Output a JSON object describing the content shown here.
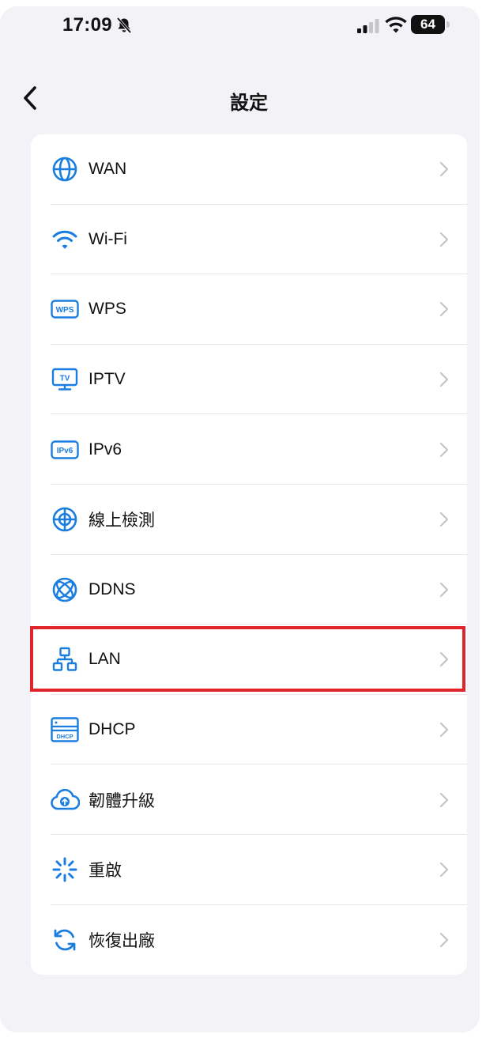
{
  "status_bar": {
    "time": "17:09",
    "battery": "64",
    "icons": [
      "bell-slash-icon",
      "cellular-signal-icon",
      "wifi-icon",
      "battery-icon"
    ]
  },
  "nav": {
    "back_icon": "chevron-left-icon",
    "title": "設定"
  },
  "settings": {
    "items": [
      {
        "label": "WAN",
        "icon": "globe-icon"
      },
      {
        "label": "Wi-Fi",
        "icon": "wifi-icon"
      },
      {
        "label": "WPS",
        "icon": "wps-icon",
        "icon_text": "WPS"
      },
      {
        "label": "IPTV",
        "icon": "tv-icon",
        "icon_text": "TV"
      },
      {
        "label": "IPv6",
        "icon": "ipv6-icon",
        "icon_text": "IPv6"
      },
      {
        "label": "線上檢測",
        "icon": "crosshair-icon"
      },
      {
        "label": "DDNS",
        "icon": "orbit-globe-icon"
      },
      {
        "label": "LAN",
        "icon": "network-topology-icon",
        "highlighted": true
      },
      {
        "label": "DHCP",
        "icon": "dhcp-server-icon",
        "icon_text": "DHCP"
      },
      {
        "label": "韌體升級",
        "icon": "cloud-upload-icon"
      },
      {
        "label": "重啟",
        "icon": "reboot-spinner-icon"
      },
      {
        "label": "恢復出廠",
        "icon": "reset-arrows-icon"
      }
    ]
  },
  "colors": {
    "accent": "#1a7de0",
    "highlight_border": "#e0242a",
    "background": "#f2f2f7",
    "card": "#ffffff",
    "chevron": "#c4c4c8"
  }
}
